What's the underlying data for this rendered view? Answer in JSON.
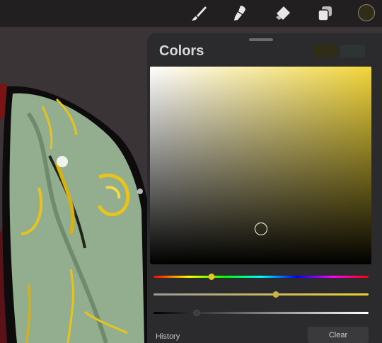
{
  "toolbar": {
    "tools": [
      {
        "name": "brush",
        "icon": "brush-icon"
      },
      {
        "name": "smudge",
        "icon": "smudge-icon"
      },
      {
        "name": "eraser",
        "icon": "eraser-icon"
      },
      {
        "name": "layers",
        "icon": "layers-icon"
      }
    ],
    "current_color": "#2f2c18"
  },
  "colors_panel": {
    "title": "Colors",
    "primary_swatch": "#2f2c18",
    "secondary_swatch": "#2c3434",
    "picker_hue_color": "#f2d63a",
    "selected": {
      "saturation": 0.5,
      "brightness": 0.18
    },
    "hue_slider": 0.27,
    "saturation_slider": 0.57,
    "brightness_slider": 0.2,
    "saturation_gradient": [
      "#9a9a96",
      "#f0d22c"
    ],
    "history_label": "History",
    "clear_label": "Clear"
  }
}
